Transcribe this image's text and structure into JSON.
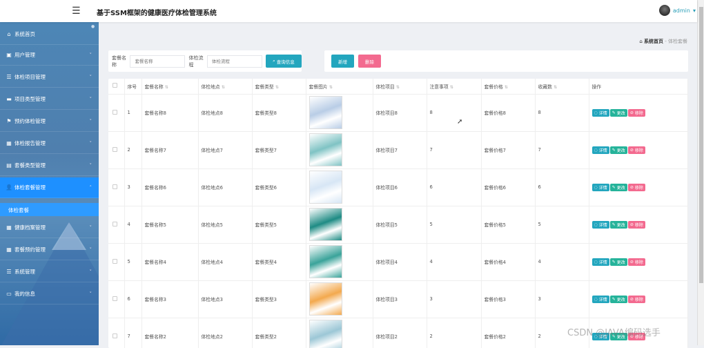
{
  "header": {
    "title": "基于SSM框架的健康医疗体检管理系统",
    "user": "admin"
  },
  "sidebar": {
    "items": [
      {
        "label": "系统首页",
        "icon": "home-icon"
      },
      {
        "label": "用户管理",
        "icon": "clipboard-icon"
      },
      {
        "label": "体检项目管理",
        "icon": "list-icon"
      },
      {
        "label": "项目类型管理",
        "icon": "ticket-icon"
      },
      {
        "label": "预约体检管理",
        "icon": "flag-icon"
      },
      {
        "label": "体检报告管理",
        "icon": "grid-icon"
      },
      {
        "label": "套餐类型管理",
        "icon": "briefcase-icon"
      },
      {
        "label": "体检套餐管理",
        "icon": "user-icon"
      },
      {
        "label": "健康档案管理",
        "icon": "grid-icon"
      },
      {
        "label": "套餐预约管理",
        "icon": "grid-icon"
      },
      {
        "label": "系统管理",
        "icon": "sliders-icon"
      },
      {
        "label": "我的信息",
        "icon": "card-icon"
      }
    ],
    "sub_active": "体检套餐"
  },
  "breadcrumb": {
    "home": "系统首页",
    "sep": "-",
    "current": "体检套餐"
  },
  "search": {
    "name_label": "套餐名称",
    "name_placeholder": "套餐名称",
    "flow_label": "体检流程",
    "flow_placeholder": "体检流程",
    "query_button": "查询信息"
  },
  "toolbar": {
    "add": "新增",
    "delete": "删除"
  },
  "table": {
    "columns": [
      "序号",
      "套餐名称",
      "体检地点",
      "套餐类型",
      "套餐图片",
      "体检项目",
      "注意事项",
      "套餐价格",
      "收藏数",
      "操作"
    ],
    "actions": {
      "detail": "详情",
      "edit": "更改",
      "remove": "移除"
    },
    "rows": [
      {
        "no": "1",
        "name": "套餐名称8",
        "place": "体检地点8",
        "type": "套餐类型8",
        "item": "体检项目8",
        "note": "8",
        "price": "套餐价格8",
        "fav": "8",
        "color": "#b9cde6"
      },
      {
        "no": "2",
        "name": "套餐名称7",
        "place": "体检地点7",
        "type": "套餐类型7",
        "item": "体检项目7",
        "note": "7",
        "price": "套餐价格7",
        "fav": "7",
        "color": "#7fc3c4"
      },
      {
        "no": "3",
        "name": "套餐名称6",
        "place": "体检地点6",
        "type": "套餐类型6",
        "item": "体检项目6",
        "note": "6",
        "price": "套餐价格6",
        "fav": "6",
        "color": "#d7e6f5"
      },
      {
        "no": "4",
        "name": "套餐名称5",
        "place": "体检地点5",
        "type": "套餐类型5",
        "item": "体检项目5",
        "note": "5",
        "price": "套餐价格5",
        "fav": "5",
        "color": "#1e8b84"
      },
      {
        "no": "5",
        "name": "套餐名称4",
        "place": "体检地点4",
        "type": "套餐类型4",
        "item": "体检项目4",
        "note": "4",
        "price": "套餐价格4",
        "fav": "4",
        "color": "#3aa39a"
      },
      {
        "no": "6",
        "name": "套餐名称3",
        "place": "体检地点3",
        "type": "套餐类型3",
        "item": "体检项目3",
        "note": "3",
        "price": "套餐价格3",
        "fav": "3",
        "color": "#f3a94e"
      },
      {
        "no": "7",
        "name": "套餐名称2",
        "place": "体检地点2",
        "type": "套餐类型2",
        "item": "体检项目2",
        "note": "2",
        "price": "套餐价格2",
        "fav": "2",
        "color": "#9cc7d6"
      }
    ]
  },
  "watermark": "CSDN @JAVA编码选手"
}
